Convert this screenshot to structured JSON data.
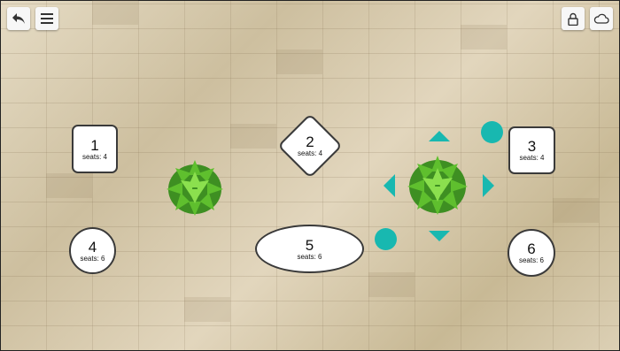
{
  "toolbar": {
    "back_icon": "back-arrow-icon",
    "menu_icon": "hamburger-menu-icon",
    "lock_icon": "lock-icon",
    "cloud_icon": "cloud-icon"
  },
  "colors": {
    "accent": "#18b8b0",
    "table_fill": "#ffffff",
    "table_border": "#3a3a3a",
    "plant": "#6bcf3a"
  },
  "tables": [
    {
      "number": "1",
      "seats": "seats: 4"
    },
    {
      "number": "2",
      "seats": "seats: 4"
    },
    {
      "number": "3",
      "seats": "seats: 4"
    },
    {
      "number": "4",
      "seats": "seats: 6"
    },
    {
      "number": "5",
      "seats": "seats: 6"
    },
    {
      "number": "6",
      "seats": "seats: 6"
    }
  ]
}
